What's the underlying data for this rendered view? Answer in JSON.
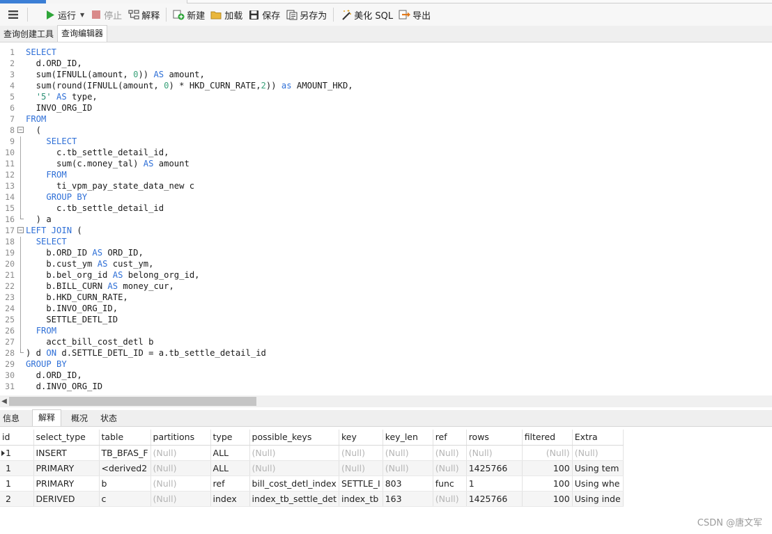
{
  "toolbar": {
    "run": "运行",
    "stop": "停止",
    "explain": "解释",
    "new": "新建",
    "load": "加载",
    "save": "保存",
    "save_as": "另存为",
    "beautify": "美化 SQL",
    "export": "导出"
  },
  "editor_tabs": [
    "查询创建工具",
    "查询编辑器"
  ],
  "code_lines": [
    [
      {
        "t": "SELECT",
        "c": "kw"
      }
    ],
    [
      {
        "t": "  d.ORD_ID,"
      }
    ],
    [
      {
        "t": "  sum(IFNULL(amount, "
      },
      {
        "t": "0",
        "c": "num"
      },
      {
        "t": ")) "
      },
      {
        "t": "AS",
        "c": "kw"
      },
      {
        "t": " amount,"
      }
    ],
    [
      {
        "t": "  sum(round(IFNULL(amount, "
      },
      {
        "t": "0",
        "c": "num"
      },
      {
        "t": ") * HKD_CURN_RATE,"
      },
      {
        "t": "2",
        "c": "num"
      },
      {
        "t": ")) "
      },
      {
        "t": "as",
        "c": "kw"
      },
      {
        "t": " AMOUNT_HKD,"
      }
    ],
    [
      {
        "t": "  "
      },
      {
        "t": "'5'",
        "c": "str"
      },
      {
        "t": " "
      },
      {
        "t": "AS",
        "c": "kw"
      },
      {
        "t": " type,"
      }
    ],
    [
      {
        "t": "  INVO_ORG_ID"
      }
    ],
    [
      {
        "t": "FROM",
        "c": "kw"
      }
    ],
    [
      {
        "t": "  ("
      }
    ],
    [
      {
        "t": "    "
      },
      {
        "t": "SELECT",
        "c": "kw"
      }
    ],
    [
      {
        "t": "      c.tb_settle_detail_id,"
      }
    ],
    [
      {
        "t": "      sum(c.money_tal) "
      },
      {
        "t": "AS",
        "c": "kw"
      },
      {
        "t": " amount"
      }
    ],
    [
      {
        "t": "    "
      },
      {
        "t": "FROM",
        "c": "kw"
      }
    ],
    [
      {
        "t": "      ti_vpm_pay_state_data_new c"
      }
    ],
    [
      {
        "t": "    "
      },
      {
        "t": "GROUP BY",
        "c": "kw"
      }
    ],
    [
      {
        "t": "      c.tb_settle_detail_id"
      }
    ],
    [
      {
        "t": "  ) a"
      }
    ],
    [
      {
        "t": "LEFT JOIN",
        "c": "kw"
      },
      {
        "t": " ("
      }
    ],
    [
      {
        "t": "  "
      },
      {
        "t": "SELECT",
        "c": "kw"
      }
    ],
    [
      {
        "t": "    b.ORD_ID "
      },
      {
        "t": "AS",
        "c": "kw"
      },
      {
        "t": " ORD_ID,"
      }
    ],
    [
      {
        "t": "    b.cust_ym "
      },
      {
        "t": "AS",
        "c": "kw"
      },
      {
        "t": " cust_ym,"
      }
    ],
    [
      {
        "t": "    b.bel_org_id "
      },
      {
        "t": "AS",
        "c": "kw"
      },
      {
        "t": " belong_org_id,"
      }
    ],
    [
      {
        "t": "    b.BILL_CURN "
      },
      {
        "t": "AS",
        "c": "kw"
      },
      {
        "t": " money_cur,"
      }
    ],
    [
      {
        "t": "    b.HKD_CURN_RATE,"
      }
    ],
    [
      {
        "t": "    b.INVO_ORG_ID,"
      }
    ],
    [
      {
        "t": "    SETTLE_DETL_ID"
      }
    ],
    [
      {
        "t": "  "
      },
      {
        "t": "FROM",
        "c": "kw"
      }
    ],
    [
      {
        "t": "    acct_bill_cost_detl b"
      }
    ],
    [
      {
        "t": ") d "
      },
      {
        "t": "ON",
        "c": "kw"
      },
      {
        "t": " d.SETTLE_DETL_ID = a.tb_settle_detail_id"
      }
    ],
    [
      {
        "t": "GROUP BY",
        "c": "kw"
      }
    ],
    [
      {
        "t": "  d.ORD_ID,"
      }
    ],
    [
      {
        "t": "  d.INVO_ORG_ID"
      }
    ]
  ],
  "result_tabs": [
    "信息",
    "解释",
    "概况",
    "状态"
  ],
  "active_result_tab": 1,
  "explain_table": {
    "columns": [
      "id",
      "select_type",
      "table",
      "partitions",
      "type",
      "possible_keys",
      "key",
      "key_len",
      "ref",
      "rows",
      "filtered",
      "Extra"
    ],
    "rows": [
      [
        "1",
        "INSERT",
        "TB_BFAS_F",
        "(Null)",
        "ALL",
        "(Null)",
        "(Null)",
        "(Null)",
        "(Null)",
        "(Null)",
        "(Null)",
        "(Null)"
      ],
      [
        "1",
        "PRIMARY",
        "<derived2",
        "(Null)",
        "ALL",
        "(Null)",
        "(Null)",
        "(Null)",
        "(Null)",
        "1425766",
        "100",
        "Using tem"
      ],
      [
        "1",
        "PRIMARY",
        "b",
        "(Null)",
        "ref",
        "bill_cost_detl_index",
        "SETTLE_I",
        "803",
        "func",
        "1",
        "100",
        "Using whe"
      ],
      [
        "2",
        "DERIVED",
        "c",
        "(Null)",
        "index",
        "index_tb_settle_det",
        "index_tb",
        "163",
        "(Null)",
        "1425766",
        "100",
        "Using inde"
      ]
    ]
  },
  "watermark": "CSDN @唐文军"
}
